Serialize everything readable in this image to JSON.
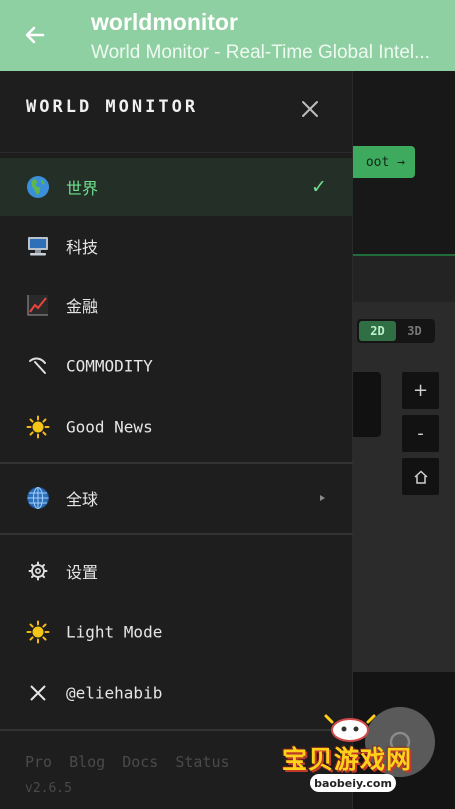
{
  "appbar": {
    "title": "worldmonitor",
    "subtitle": "World Monitor - Real-Time Global Intel..."
  },
  "background_page": {
    "cta_label": "oot →",
    "view_toggle": [
      "2D",
      "3D"
    ],
    "view_selected": "2D",
    "zoom_in": "+",
    "zoom_out": "-"
  },
  "drawer": {
    "brand": "WORLD MONITOR",
    "variants": [
      {
        "label": "世界",
        "icon": "globe-europe-africa-icon",
        "selected": true
      },
      {
        "label": "科技",
        "icon": "desktop-computer-icon"
      },
      {
        "label": "金融",
        "icon": "chart-increasing-icon"
      },
      {
        "label": "COMMODITY",
        "icon": "pick-icon"
      },
      {
        "label": "Good News",
        "icon": "sun-icon"
      }
    ],
    "region": {
      "label": "全球",
      "icon": "globe-with-meridians-icon"
    },
    "settings": [
      {
        "label": "设置",
        "icon": "gear-icon"
      },
      {
        "label": "Light Mode",
        "icon": "sun-icon"
      },
      {
        "label": "@eliehabib",
        "icon": "x-logo-icon"
      }
    ],
    "footer_links": [
      "Pro",
      "Blog",
      "Docs",
      "Status"
    ],
    "version": "v2.6.5"
  },
  "watermark": {
    "text": "宝贝游戏网",
    "url": "baobeiy.com"
  },
  "colors": {
    "appbar": "#8fd0a2",
    "accent": "#6fe08e",
    "drawer_bg": "#1e1e1e"
  }
}
